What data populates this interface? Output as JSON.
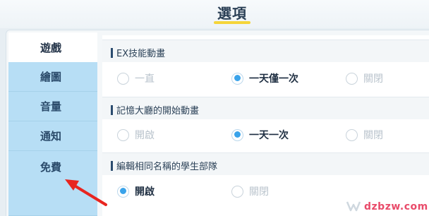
{
  "header": {
    "title": "選項"
  },
  "sidebar": {
    "items": [
      {
        "label": "遊戲",
        "active": true
      },
      {
        "label": "繪圖",
        "active": false
      },
      {
        "label": "音量",
        "active": false
      },
      {
        "label": "通知",
        "active": false
      },
      {
        "label": "免費",
        "active": false
      }
    ]
  },
  "settings": [
    {
      "label": "EX技能動畫",
      "options": [
        {
          "label": "一直",
          "selected": false
        },
        {
          "label": "一天僅一次",
          "selected": true
        },
        {
          "label": "關閉",
          "selected": false
        }
      ]
    },
    {
      "label": "記憶大廳的開始動畫",
      "options": [
        {
          "label": "開啟",
          "selected": false
        },
        {
          "label": "一天一次",
          "selected": true
        },
        {
          "label": "關閉",
          "selected": false
        }
      ]
    },
    {
      "label": "編輯相同名稱的學生部隊",
      "options": [
        {
          "label": "開啟",
          "selected": true
        },
        {
          "label": "關閉",
          "selected": false
        }
      ]
    }
  ],
  "watermark": "dzbzw.com",
  "colors": {
    "accent": "#3aa3ea",
    "sidebar": "#b7def5",
    "title_underline": "#f5d53a",
    "annotation_arrow": "#e8251f"
  }
}
